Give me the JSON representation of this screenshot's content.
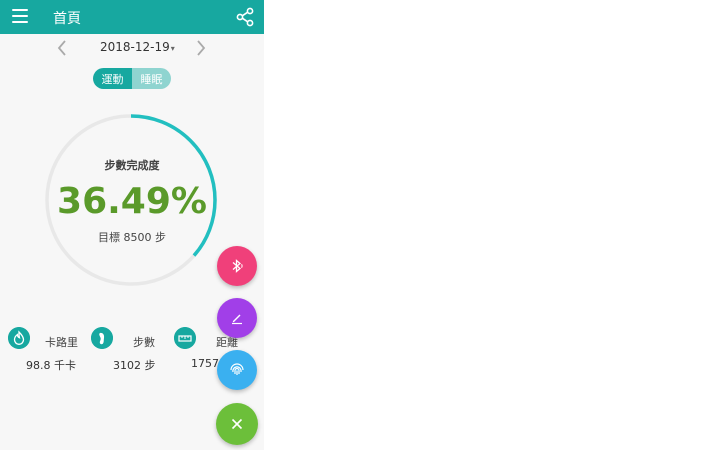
{
  "appbar": {
    "title": "首頁",
    "color": "#17a8a0"
  },
  "date_nav": {
    "date": "2018-12-19"
  },
  "mode_toggle": {
    "active": "運動",
    "inactive": "睡眠"
  },
  "progress": {
    "title": "步數完成度",
    "percent_text": "36.49%",
    "percent": 36.49,
    "target_text": "目標 8500 步",
    "ring_color": "#22bfc0",
    "value_color": "#5a9a2a"
  },
  "stats": [
    {
      "icon": "flame-icon",
      "label": "卡路里",
      "value": "98.8 千卡"
    },
    {
      "icon": "footprint-icon",
      "label": "步數",
      "value": "3102 步"
    },
    {
      "icon": "ruler-icon",
      "label": "距離",
      "value": "1757"
    }
  ],
  "fabs": [
    {
      "icon": "bluetooth-icon",
      "color": "#f0407a"
    },
    {
      "icon": "edit-icon",
      "color": "#a13fe8"
    },
    {
      "icon": "fingerprint-icon",
      "color": "#3ab0f0"
    },
    {
      "icon": "close-icon",
      "color": "#6cbf3a"
    }
  ]
}
